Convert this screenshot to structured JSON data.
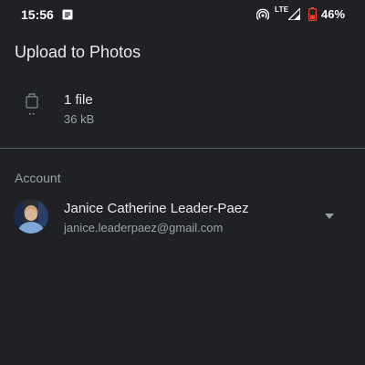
{
  "status_bar": {
    "time": "15:56",
    "network": "LTE",
    "battery_percent": "46%",
    "battery_level": 0.46,
    "icons": [
      "notification-icon",
      "hotspot-icon",
      "signal-icon",
      "battery-icon"
    ]
  },
  "dialog": {
    "title": "Upload to Photos"
  },
  "file": {
    "count_label": "1 file",
    "size_label": "36 kB",
    "icon": "file-icon"
  },
  "account": {
    "header": "Account",
    "name": "Janice Catherine Leader-Paez",
    "email": "janice.leaderpaez@gmail.com",
    "icon": "chevron-down-icon"
  },
  "colors": {
    "background": "#202124",
    "primary_text": "#e8eaed",
    "secondary_text": "#9aa0a6",
    "divider": "#5f6368",
    "battery_low": "#ea4335"
  }
}
